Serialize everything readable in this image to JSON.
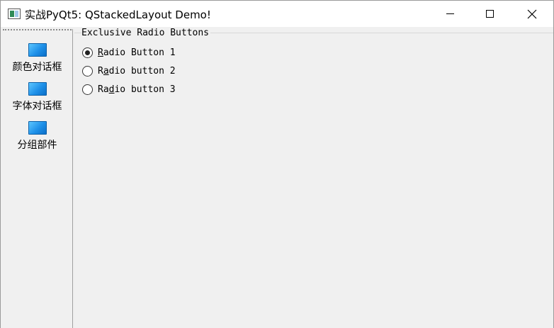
{
  "window": {
    "title": "实战PyQt5: QStackedLayout Demo!"
  },
  "sidebar": {
    "items": [
      {
        "label": "颜色对话框",
        "icon": "monitor-icon"
      },
      {
        "label": "字体对话框",
        "icon": "monitor-icon"
      },
      {
        "label": "分组部件",
        "icon": "monitor-icon"
      }
    ]
  },
  "group": {
    "title": "Exclusive Radio Buttons",
    "radios": [
      {
        "mnemonic": "R",
        "rest": "adio Button 1",
        "checked": true
      },
      {
        "pre": "R",
        "mnemonic": "a",
        "rest": "dio button 2",
        "checked": false
      },
      {
        "pre": "Ra",
        "mnemonic": "d",
        "rest": "io button 3",
        "checked": false
      }
    ]
  },
  "colors": {
    "accent_icon": "#1e90e8",
    "titlebar_bg": "#ffffff",
    "window_bg": "#f0f0f0"
  }
}
